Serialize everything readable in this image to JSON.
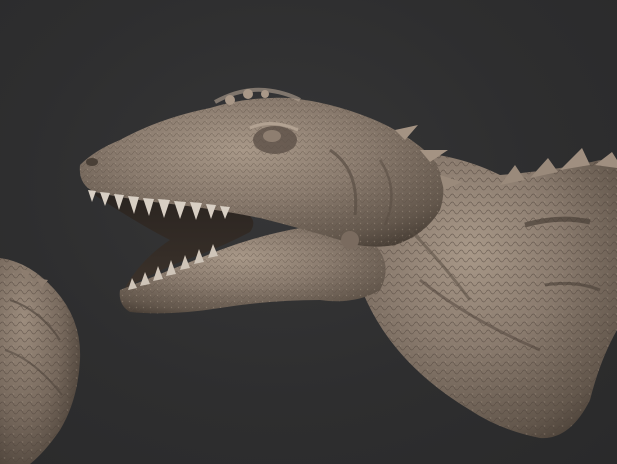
{
  "viewport": {
    "background_color": "#2f2f30",
    "model_color": "#8a7b6e",
    "model_highlight": "#a89888",
    "model_shadow": "#4a4037",
    "tooth_color": "#d8cfc4"
  },
  "subjects": [
    {
      "name": "dinosaur-head-sculpt"
    },
    {
      "name": "partial-sculpt-left"
    }
  ]
}
